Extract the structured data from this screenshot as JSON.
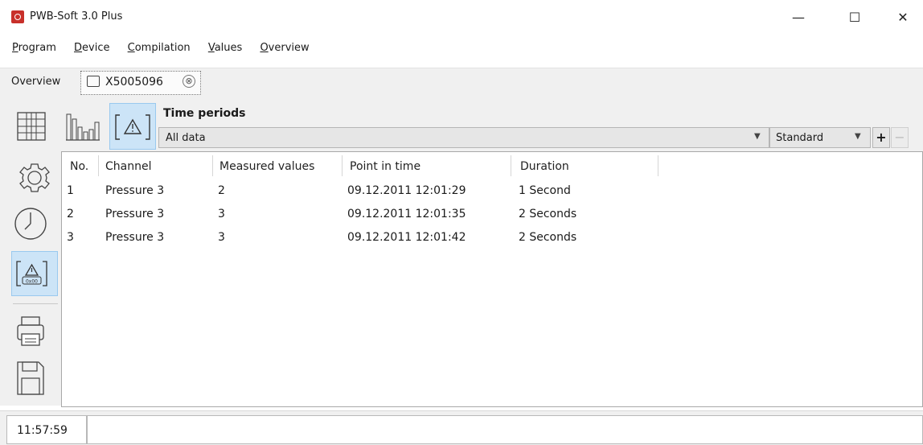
{
  "window": {
    "title": "PWB-Soft 3.0 Plus",
    "minimize": "—",
    "maximize": "☐",
    "close": "✕"
  },
  "menu": [
    {
      "first": "P",
      "rest": "rogram"
    },
    {
      "first": "D",
      "rest": "evice"
    },
    {
      "first": "C",
      "rest": "ompilation"
    },
    {
      "first": "V",
      "rest": "alues"
    },
    {
      "first": "O",
      "rest": "verview"
    }
  ],
  "tabs": {
    "overview": "Overview",
    "device": "X5005096",
    "close_glyph": "⊗"
  },
  "toolbar": {
    "time_periods_label": "Time periods",
    "period_value": "All data",
    "standard_value": "Standard",
    "add": "+",
    "remove": "−",
    "accent": "#cce4f7"
  },
  "sidebar": {
    "warning_badge": "0x00"
  },
  "table": {
    "headers": [
      "No.",
      "Channel",
      "Measured values",
      "Point in time",
      "Duration"
    ],
    "rows": [
      [
        "1",
        "Pressure 3",
        "2",
        "09.12.2011 12:01:29",
        "1 Second"
      ],
      [
        "2",
        "Pressure 3",
        "3",
        "09.12.2011 12:01:35",
        "2 Seconds"
      ],
      [
        "3",
        "Pressure 3",
        "3",
        "09.12.2011 12:01:42",
        "2 Seconds"
      ]
    ]
  },
  "status": {
    "time": "11:57:59"
  }
}
